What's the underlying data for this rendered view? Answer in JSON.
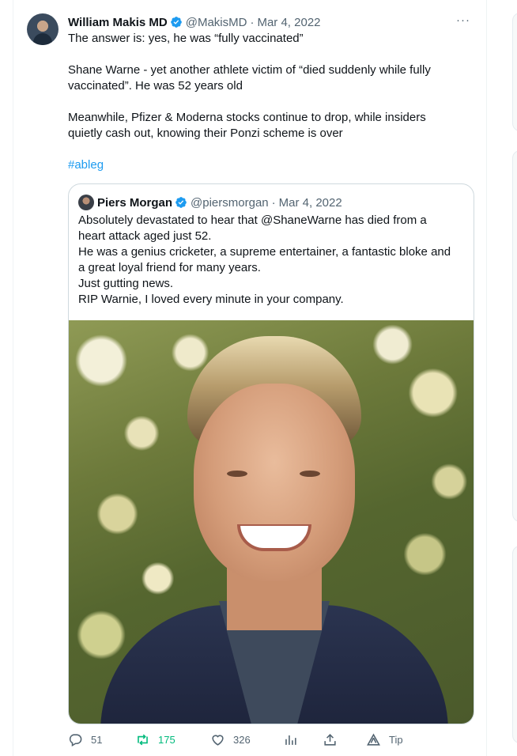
{
  "author": {
    "name": "William Makis MD",
    "handle": "@MakisMD",
    "separator": "·",
    "date": "Mar 4, 2022"
  },
  "more_label": "···",
  "body": {
    "line1": "The answer is: yes, he was “fully vaccinated”",
    "line2": "Shane Warne - yet another athlete victim of “died suddenly while fully vaccinated”. He was 52 years old",
    "line3": "Meanwhile, Pfizer & Moderna stocks continue to drop, while insiders quietly cash out, knowing their Ponzi scheme is over",
    "hashtag": "#ableg"
  },
  "quoted": {
    "name": "Piers Morgan",
    "handle": "@piersmorgan",
    "separator": "·",
    "date": "Mar 4, 2022",
    "lines": [
      "Absolutely devastated to hear that @ShaneWarne has died from a",
      "heart attack aged just 52.",
      "He was a genius cricketer, a  supreme entertainer, a fantastic bloke and",
      "a great loyal friend for many years.",
      "Just gutting news.",
      "RIP Warnie, I loved every minute in your company."
    ]
  },
  "actions": {
    "replies": "51",
    "retweets": "175",
    "likes": "326",
    "tip": "Tip"
  },
  "colors": {
    "accent": "#1d9bf0",
    "retweet": "#00ba7c",
    "muted": "#536471"
  }
}
